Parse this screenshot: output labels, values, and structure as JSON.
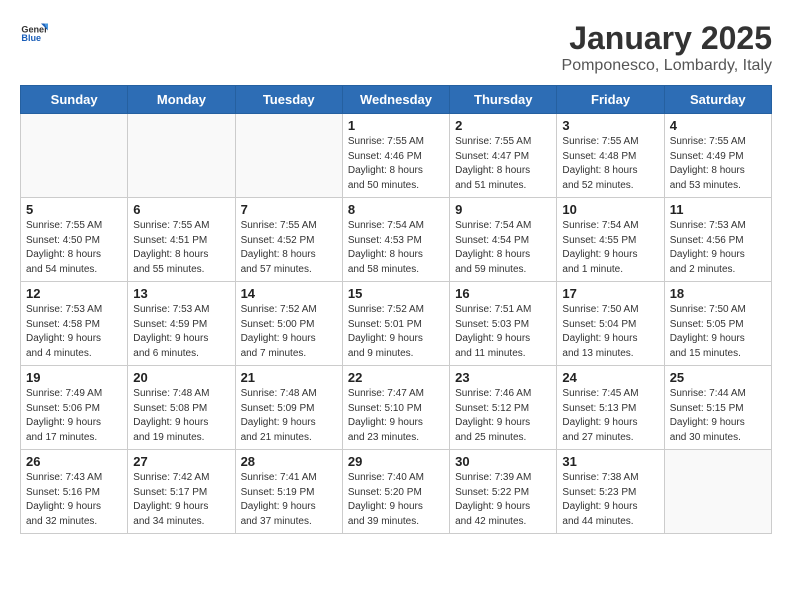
{
  "header": {
    "logo_general": "General",
    "logo_blue": "Blue",
    "title": "January 2025",
    "subtitle": "Pomponesco, Lombardy, Italy"
  },
  "weekdays": [
    "Sunday",
    "Monday",
    "Tuesday",
    "Wednesday",
    "Thursday",
    "Friday",
    "Saturday"
  ],
  "weeks": [
    [
      {
        "day": "",
        "info": ""
      },
      {
        "day": "",
        "info": ""
      },
      {
        "day": "",
        "info": ""
      },
      {
        "day": "1",
        "info": "Sunrise: 7:55 AM\nSunset: 4:46 PM\nDaylight: 8 hours\nand 50 minutes."
      },
      {
        "day": "2",
        "info": "Sunrise: 7:55 AM\nSunset: 4:47 PM\nDaylight: 8 hours\nand 51 minutes."
      },
      {
        "day": "3",
        "info": "Sunrise: 7:55 AM\nSunset: 4:48 PM\nDaylight: 8 hours\nand 52 minutes."
      },
      {
        "day": "4",
        "info": "Sunrise: 7:55 AM\nSunset: 4:49 PM\nDaylight: 8 hours\nand 53 minutes."
      }
    ],
    [
      {
        "day": "5",
        "info": "Sunrise: 7:55 AM\nSunset: 4:50 PM\nDaylight: 8 hours\nand 54 minutes."
      },
      {
        "day": "6",
        "info": "Sunrise: 7:55 AM\nSunset: 4:51 PM\nDaylight: 8 hours\nand 55 minutes."
      },
      {
        "day": "7",
        "info": "Sunrise: 7:55 AM\nSunset: 4:52 PM\nDaylight: 8 hours\nand 57 minutes."
      },
      {
        "day": "8",
        "info": "Sunrise: 7:54 AM\nSunset: 4:53 PM\nDaylight: 8 hours\nand 58 minutes."
      },
      {
        "day": "9",
        "info": "Sunrise: 7:54 AM\nSunset: 4:54 PM\nDaylight: 8 hours\nand 59 minutes."
      },
      {
        "day": "10",
        "info": "Sunrise: 7:54 AM\nSunset: 4:55 PM\nDaylight: 9 hours\nand 1 minute."
      },
      {
        "day": "11",
        "info": "Sunrise: 7:53 AM\nSunset: 4:56 PM\nDaylight: 9 hours\nand 2 minutes."
      }
    ],
    [
      {
        "day": "12",
        "info": "Sunrise: 7:53 AM\nSunset: 4:58 PM\nDaylight: 9 hours\nand 4 minutes."
      },
      {
        "day": "13",
        "info": "Sunrise: 7:53 AM\nSunset: 4:59 PM\nDaylight: 9 hours\nand 6 minutes."
      },
      {
        "day": "14",
        "info": "Sunrise: 7:52 AM\nSunset: 5:00 PM\nDaylight: 9 hours\nand 7 minutes."
      },
      {
        "day": "15",
        "info": "Sunrise: 7:52 AM\nSunset: 5:01 PM\nDaylight: 9 hours\nand 9 minutes."
      },
      {
        "day": "16",
        "info": "Sunrise: 7:51 AM\nSunset: 5:03 PM\nDaylight: 9 hours\nand 11 minutes."
      },
      {
        "day": "17",
        "info": "Sunrise: 7:50 AM\nSunset: 5:04 PM\nDaylight: 9 hours\nand 13 minutes."
      },
      {
        "day": "18",
        "info": "Sunrise: 7:50 AM\nSunset: 5:05 PM\nDaylight: 9 hours\nand 15 minutes."
      }
    ],
    [
      {
        "day": "19",
        "info": "Sunrise: 7:49 AM\nSunset: 5:06 PM\nDaylight: 9 hours\nand 17 minutes."
      },
      {
        "day": "20",
        "info": "Sunrise: 7:48 AM\nSunset: 5:08 PM\nDaylight: 9 hours\nand 19 minutes."
      },
      {
        "day": "21",
        "info": "Sunrise: 7:48 AM\nSunset: 5:09 PM\nDaylight: 9 hours\nand 21 minutes."
      },
      {
        "day": "22",
        "info": "Sunrise: 7:47 AM\nSunset: 5:10 PM\nDaylight: 9 hours\nand 23 minutes."
      },
      {
        "day": "23",
        "info": "Sunrise: 7:46 AM\nSunset: 5:12 PM\nDaylight: 9 hours\nand 25 minutes."
      },
      {
        "day": "24",
        "info": "Sunrise: 7:45 AM\nSunset: 5:13 PM\nDaylight: 9 hours\nand 27 minutes."
      },
      {
        "day": "25",
        "info": "Sunrise: 7:44 AM\nSunset: 5:15 PM\nDaylight: 9 hours\nand 30 minutes."
      }
    ],
    [
      {
        "day": "26",
        "info": "Sunrise: 7:43 AM\nSunset: 5:16 PM\nDaylight: 9 hours\nand 32 minutes."
      },
      {
        "day": "27",
        "info": "Sunrise: 7:42 AM\nSunset: 5:17 PM\nDaylight: 9 hours\nand 34 minutes."
      },
      {
        "day": "28",
        "info": "Sunrise: 7:41 AM\nSunset: 5:19 PM\nDaylight: 9 hours\nand 37 minutes."
      },
      {
        "day": "29",
        "info": "Sunrise: 7:40 AM\nSunset: 5:20 PM\nDaylight: 9 hours\nand 39 minutes."
      },
      {
        "day": "30",
        "info": "Sunrise: 7:39 AM\nSunset: 5:22 PM\nDaylight: 9 hours\nand 42 minutes."
      },
      {
        "day": "31",
        "info": "Sunrise: 7:38 AM\nSunset: 5:23 PM\nDaylight: 9 hours\nand 44 minutes."
      },
      {
        "day": "",
        "info": ""
      }
    ]
  ]
}
